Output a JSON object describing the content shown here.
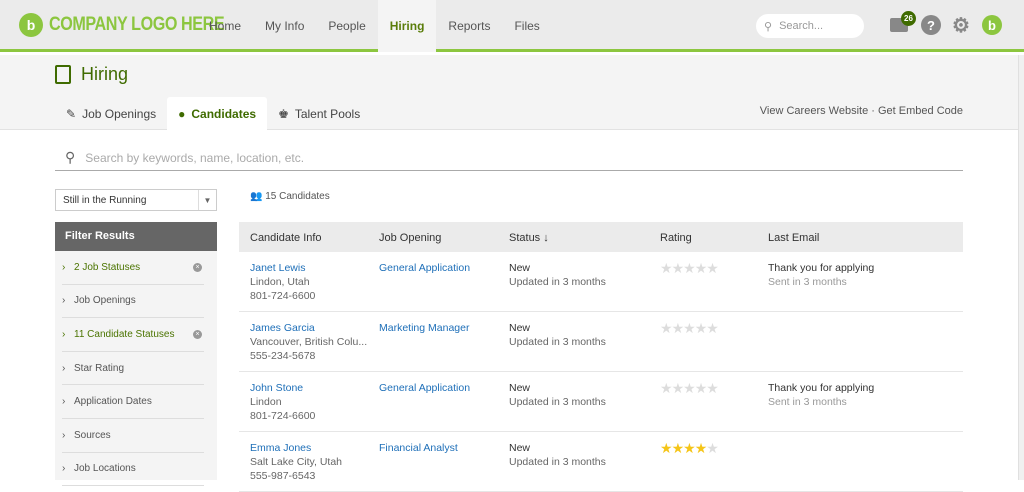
{
  "nav": {
    "logo": "COMPANY LOGO HERE",
    "items": [
      "Home",
      "My Info",
      "People",
      "Hiring",
      "Reports",
      "Files"
    ],
    "active": 3,
    "search_placeholder": "Search...",
    "inbox_count": "26"
  },
  "page": {
    "title": "Hiring",
    "tabs": [
      "Job Openings",
      "Candidates",
      "Talent Pools"
    ],
    "active_tab": 1,
    "link_careers": "View Careers Website",
    "link_sep": "·",
    "link_embed": "Get Embed Code",
    "search_placeholder": "Search by keywords, name, location, etc."
  },
  "filter": {
    "dropdown": "Still in the Running",
    "header": "Filter Results",
    "items": [
      {
        "label": "2 Job Statuses",
        "active": true
      },
      {
        "label": "Job Openings",
        "active": false
      },
      {
        "label": "11 Candidate Statuses",
        "active": true
      },
      {
        "label": "Star Rating",
        "active": false
      },
      {
        "label": "Application Dates",
        "active": false
      },
      {
        "label": "Sources",
        "active": false
      },
      {
        "label": "Job Locations",
        "active": false
      }
    ]
  },
  "results": {
    "count": "15 Candidates",
    "columns": [
      "Candidate Info",
      "Job Opening",
      "Status ↓",
      "Rating",
      "Last Email"
    ],
    "rows": [
      {
        "name": "Janet Lewis",
        "location": "Lindon, Utah",
        "phone": "801-724-6600",
        "job": "General Application",
        "status": "New",
        "updated": "Updated in 3 months",
        "rating": 0,
        "email": "Thank you for applying",
        "sent": "Sent in 3 months"
      },
      {
        "name": "James Garcia",
        "location": "Vancouver, British Colu...",
        "phone": "555-234-5678",
        "job": "Marketing Manager",
        "status": "New",
        "updated": "Updated in 3 months",
        "rating": 0,
        "email": "",
        "sent": ""
      },
      {
        "name": "John Stone",
        "location": "Lindon",
        "phone": "801-724-6600",
        "job": "General Application",
        "status": "New",
        "updated": "Updated in 3 months",
        "rating": 0,
        "email": "Thank you for applying",
        "sent": "Sent in 3 months"
      },
      {
        "name": "Emma Jones",
        "location": "Salt Lake City, Utah",
        "phone": "555-987-6543",
        "job": "Financial Analyst",
        "status": "New",
        "updated": "Updated in 3 months",
        "rating": 4,
        "email": "",
        "sent": ""
      }
    ]
  },
  "colors": {
    "brand": "#8cc63f",
    "dark_green": "#3f6b00",
    "link": "#1e6fb8",
    "star": "#f5c518"
  }
}
